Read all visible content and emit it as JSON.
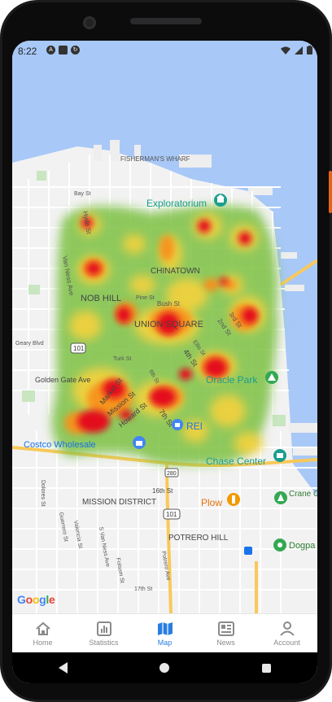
{
  "status_bar": {
    "time": "8:22",
    "left_icons": [
      "a-icon",
      "sd-card-icon",
      "sync-icon"
    ],
    "right_icons": [
      "wifi-icon",
      "signal-icon",
      "battery-icon"
    ]
  },
  "map": {
    "labels": {
      "fishermans_wharf": "FISHERMAN'S WHARF",
      "exploratorium": "Exploratorium",
      "chinatown": "CHINATOWN",
      "nob_hill": "NOB HILL",
      "union_square": "UNION SQUARE",
      "oracle_park": "Oracle Park",
      "rei": "REI",
      "costco": "Costco Wholesale",
      "chase_center": "Chase Center",
      "mission_district": "MISSION DISTRICT",
      "potrero_hill": "POTRERO HILL",
      "plow": "Plow",
      "crane_cove": "Crane Cove P",
      "dogpatch": "Dogpa",
      "golden_gate_ave": "Golden Gate Ave",
      "geary_blvd": "Geary Blvd",
      "hyde_st": "Hyde St",
      "van_ness_ave": "Van Ness Ave",
      "bush_st": "Bush St",
      "market_st": "Market St",
      "mission_st": "Mission St",
      "howard_st": "Howard St",
      "8th_st": "8th St",
      "7th_st": "7th St",
      "4th_st": "4th St",
      "2nd_st": "2nd St",
      "3rd_st": "3rd St",
      "16th_st": "16th St",
      "bay_st": "Bay St",
      "pine_st": "Pine St",
      "turk_st": "Turk St",
      "hwy_101_north": "101",
      "hwy_101_south": "101",
      "hwy_280": "280",
      "dolores_st": "Dolores St",
      "valencia_st": "Valencia St",
      "guerrero_st": "Guerrero St",
      "van_ness_ave_south": "S Van Ness Ave",
      "folsom_st": "Folsom St",
      "potrero_ave": "Potrero Ave",
      "17th_st": "17th St",
      "ellis_st": "Ellis St"
    },
    "attribution": {
      "letters": [
        "G",
        "o",
        "o",
        "g",
        "l",
        "e"
      ],
      "colors": [
        "#4285F4",
        "#EA4335",
        "#FBBC05",
        "#4285F4",
        "#34A853",
        "#EA4335"
      ]
    },
    "heat_colors": {
      "low": "#7cc142",
      "mid": "#f5d23c",
      "high": "#f7921e",
      "peak": "#e4101b"
    }
  },
  "tabs": [
    {
      "label": "Home",
      "icon": "home-icon"
    },
    {
      "label": "Statistics",
      "icon": "statistics-icon"
    },
    {
      "label": "Map",
      "icon": "map-icon",
      "active": true
    },
    {
      "label": "News",
      "icon": "news-icon"
    },
    {
      "label": "Account",
      "icon": "account-icon"
    }
  ],
  "colors": {
    "accent": "#2a7de1",
    "inactive": "#8a8a8a",
    "water": "#a8c8f7",
    "land": "#f2f2f2"
  }
}
